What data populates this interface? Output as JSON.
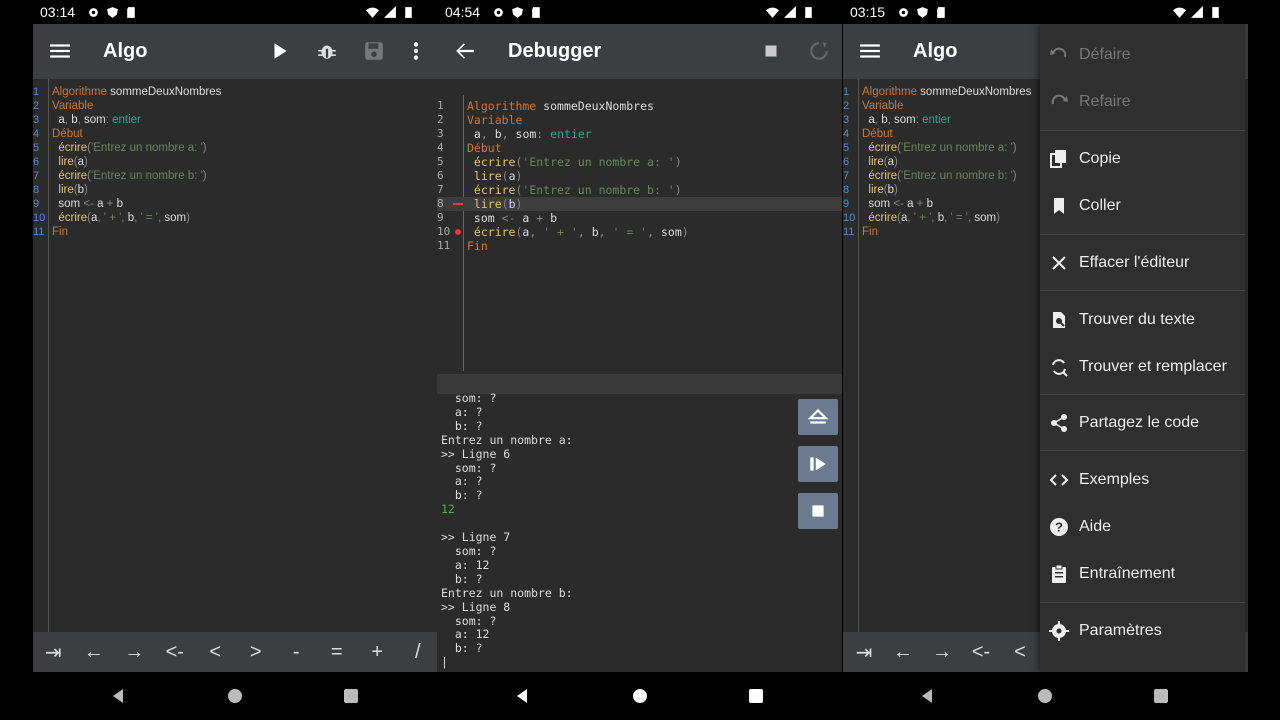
{
  "status": {
    "left_time": "03:14",
    "mid_time": "04:54",
    "right_time": "03:15"
  },
  "left": {
    "title": "Algo",
    "code": [
      {
        "n": "1",
        "parts": [
          [
            "kw",
            "Algorithme "
          ],
          [
            "pl",
            "sommeDeuxNombres"
          ]
        ]
      },
      {
        "n": "2",
        "parts": [
          [
            "kw",
            "Variable"
          ]
        ]
      },
      {
        "n": "3",
        "parts": [
          [
            "pl",
            "  a"
          ],
          [
            "op",
            ", "
          ],
          [
            "pl",
            "b"
          ],
          [
            "op",
            ", "
          ],
          [
            "pl",
            "som"
          ],
          [
            "op",
            ": "
          ],
          [
            "ty",
            "entier"
          ]
        ]
      },
      {
        "n": "4",
        "parts": [
          [
            "kw",
            "Début"
          ]
        ]
      },
      {
        "n": "5",
        "parts": [
          [
            "fn",
            "  écrire"
          ],
          [
            "op",
            "("
          ],
          [
            "str",
            "'Entrez un nombre a: '"
          ],
          [
            "op",
            ")"
          ]
        ]
      },
      {
        "n": "6",
        "parts": [
          [
            "fn",
            "  lire"
          ],
          [
            "op",
            "("
          ],
          [
            "pl",
            "a"
          ],
          [
            "op",
            ")"
          ]
        ]
      },
      {
        "n": "7",
        "parts": [
          [
            "fn",
            "  écrire"
          ],
          [
            "op",
            "("
          ],
          [
            "str",
            "'Entrez un nombre b: '"
          ],
          [
            "op",
            ")"
          ]
        ]
      },
      {
        "n": "8",
        "parts": [
          [
            "fn",
            "  lire"
          ],
          [
            "op",
            "("
          ],
          [
            "pl",
            "b"
          ],
          [
            "op",
            ")"
          ]
        ]
      },
      {
        "n": "9",
        "parts": [
          [
            "pl",
            "  som "
          ],
          [
            "op",
            "<- "
          ],
          [
            "pl",
            "a "
          ],
          [
            "op",
            "+ "
          ],
          [
            "pl",
            "b"
          ]
        ]
      },
      {
        "n": "10",
        "parts": [
          [
            "fn",
            "  écrire"
          ],
          [
            "op",
            "("
          ],
          [
            "pl",
            "a"
          ],
          [
            "op",
            ", "
          ],
          [
            "str",
            "' + '"
          ],
          [
            "op",
            ", "
          ],
          [
            "pl",
            "b"
          ],
          [
            "op",
            ", "
          ],
          [
            "str",
            "' = '"
          ],
          [
            "op",
            ", "
          ],
          [
            "pl",
            "som"
          ],
          [
            "op",
            ")"
          ]
        ]
      },
      {
        "n": "11",
        "parts": [
          [
            "kw",
            "Fin"
          ]
        ]
      }
    ],
    "keys": [
      "⇥",
      "←",
      "→",
      "<-",
      "<",
      ">",
      "-",
      "=",
      "+",
      "/"
    ]
  },
  "middle": {
    "title": "Debugger",
    "code": [
      {
        "n": "1",
        "parts": [
          [
            "kw",
            "Algorithme "
          ],
          [
            "pl",
            "sommeDeuxNombres"
          ]
        ]
      },
      {
        "n": "2",
        "parts": [
          [
            "kw",
            "Variable"
          ]
        ]
      },
      {
        "n": "3",
        "parts": [
          [
            "pl",
            " a"
          ],
          [
            "op",
            ", "
          ],
          [
            "pl",
            "b"
          ],
          [
            "op",
            ", "
          ],
          [
            "pl",
            "som"
          ],
          [
            "op",
            ": "
          ],
          [
            "ty",
            "entier"
          ]
        ]
      },
      {
        "n": "4",
        "parts": [
          [
            "kw",
            "Début"
          ]
        ]
      },
      {
        "n": "5",
        "parts": [
          [
            "fn",
            " écrire"
          ],
          [
            "op",
            "("
          ],
          [
            "str",
            "'Entrez un nombre a: '"
          ],
          [
            "op",
            ")"
          ]
        ]
      },
      {
        "n": "6",
        "parts": [
          [
            "fn",
            " lire"
          ],
          [
            "op",
            "("
          ],
          [
            "pl",
            "a"
          ],
          [
            "op",
            ")"
          ]
        ]
      },
      {
        "n": "7",
        "parts": [
          [
            "fn",
            " écrire"
          ],
          [
            "op",
            "("
          ],
          [
            "str",
            "'Entrez un nombre b: '"
          ],
          [
            "op",
            ")"
          ]
        ]
      },
      {
        "n": "8",
        "parts": [
          [
            "fn",
            " lire"
          ],
          [
            "op",
            "("
          ],
          [
            "pl",
            "b"
          ],
          [
            "op",
            ")"
          ]
        ]
      },
      {
        "n": "9",
        "parts": [
          [
            "pl",
            " som "
          ],
          [
            "op",
            "<- "
          ],
          [
            "pl",
            "a "
          ],
          [
            "op",
            "+ "
          ],
          [
            "pl",
            "b"
          ]
        ]
      },
      {
        "n": "10",
        "parts": [
          [
            "fn",
            " écrire"
          ],
          [
            "op",
            "("
          ],
          [
            "pl",
            "a"
          ],
          [
            "op",
            ", "
          ],
          [
            "str",
            "' + '"
          ],
          [
            "op",
            ", "
          ],
          [
            "pl",
            "b"
          ],
          [
            "op",
            ", "
          ],
          [
            "str",
            "' = '"
          ],
          [
            "op",
            ", "
          ],
          [
            "pl",
            "som"
          ],
          [
            "op",
            ")"
          ]
        ]
      },
      {
        "n": "11",
        "parts": [
          [
            "kw",
            "Fin"
          ]
        ]
      }
    ],
    "current_line": 8,
    "breakpoint_line": 10,
    "console": [
      {
        "t": "  som: ?"
      },
      {
        "t": "  a: ?"
      },
      {
        "t": "  b: ?"
      },
      {
        "t": "Entrez un nombre a:"
      },
      {
        "t": ">> Ligne 6"
      },
      {
        "t": "  som: ?"
      },
      {
        "t": "  a: ?"
      },
      {
        "t": "  b: ?"
      },
      {
        "t": "12",
        "green": true
      },
      {
        "t": ""
      },
      {
        "t": ">> Ligne 7"
      },
      {
        "t": "  som: ?"
      },
      {
        "t": "  a: 12"
      },
      {
        "t": "  b: ?"
      },
      {
        "t": "Entrez un nombre b:"
      },
      {
        "t": ">> Ligne 8"
      },
      {
        "t": "  som: ?"
      },
      {
        "t": "  a: 12"
      },
      {
        "t": "  b: ?"
      },
      {
        "t": "|"
      }
    ]
  },
  "right": {
    "title": "Algo",
    "keys": [
      "⇥",
      "←",
      "→",
      "<-",
      "<"
    ]
  },
  "menu": {
    "items": [
      {
        "label": "Défaire",
        "icon": "undo-icon",
        "disabled": true
      },
      {
        "label": "Refaire",
        "icon": "redo-icon",
        "disabled": true
      },
      {
        "label": "Copie",
        "icon": "copy-icon"
      },
      {
        "label": "Coller",
        "icon": "bookmark-icon"
      },
      {
        "label": "Effacer l'éditeur",
        "icon": "close-icon"
      },
      {
        "label": "Trouver du texte",
        "icon": "find-icon"
      },
      {
        "label": "Trouver et remplacer",
        "icon": "find-replace-icon"
      },
      {
        "label": "Partagez le code",
        "icon": "share-icon"
      },
      {
        "label": "Exemples",
        "icon": "code-icon"
      },
      {
        "label": "Aide",
        "icon": "help-icon"
      },
      {
        "label": "Entraînement",
        "icon": "clipboard-icon"
      },
      {
        "label": "Paramètres",
        "icon": "gear-icon"
      }
    ]
  }
}
